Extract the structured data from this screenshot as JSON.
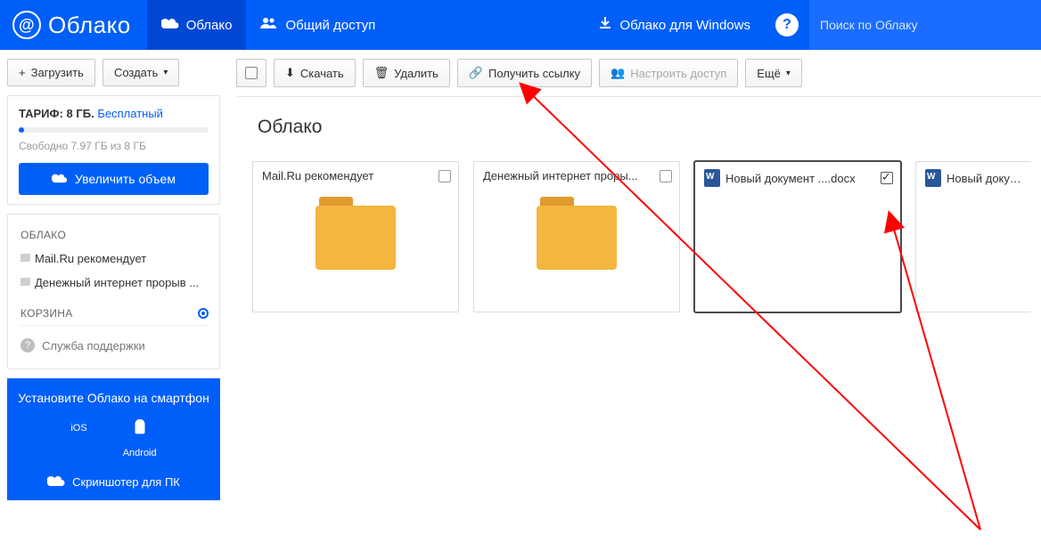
{
  "header": {
    "logo_text": "Облако",
    "nav_cloud": "Облако",
    "nav_shared": "Общий доступ",
    "nav_windows": "Облако для Windows",
    "search_placeholder": "Поиск по Облаку"
  },
  "left": {
    "upload": "Загрузить",
    "create": "Создать",
    "tariff_label": "ТАРИФ: 8 ГБ.",
    "tariff_plan": "Бесплатный",
    "free_line": "Свободно 7.97 ГБ из 8 ГБ",
    "enlarge": "Увеличить объем",
    "section_cloud": "ОБЛАКО",
    "items": [
      {
        "label": "Mail.Ru рекомендует"
      },
      {
        "label": "Денежный интернет прорыв ..."
      }
    ],
    "section_trash": "КОРЗИНА",
    "support": "Служба поддержки",
    "promo_title": "Установите Облако на смартфон",
    "promo_ios": "iOS",
    "promo_android": "Android",
    "promo_scr": "Скриншотер для ПК"
  },
  "toolbar": {
    "download": "Скачать",
    "delete": "Удалить",
    "get_link": "Получить ссылку",
    "configure": "Настроить доступ",
    "more": "Ещё"
  },
  "crumb": "Облако",
  "files": [
    {
      "label": "Mail.Ru рекомендует",
      "type": "folder",
      "checked": false
    },
    {
      "label": "Денежный интернет проры...",
      "type": "folder",
      "checked": false
    },
    {
      "label": "Новый документ ....docx",
      "type": "doc",
      "checked": true
    },
    {
      "label": "Новый докумен",
      "type": "doc",
      "checked": false
    }
  ]
}
